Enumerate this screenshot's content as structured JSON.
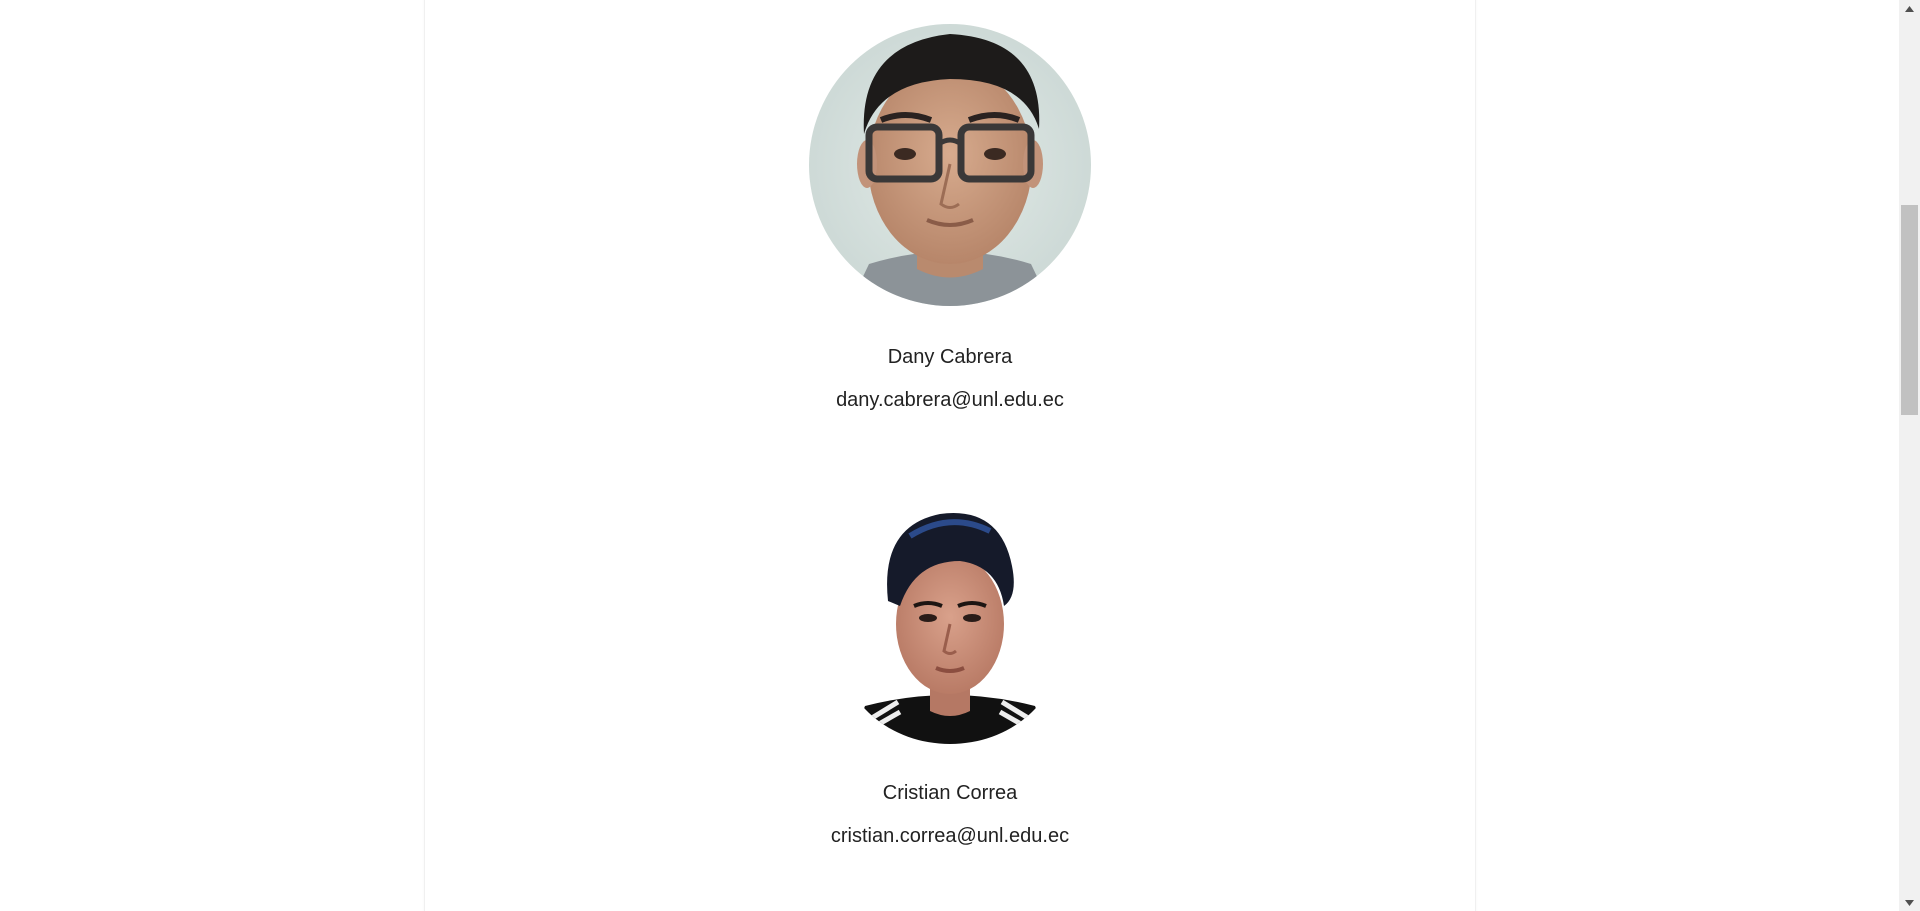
{
  "team": {
    "members": [
      {
        "name": "Dany Cabrera",
        "email": "dany.cabrera@unl.edu.ec",
        "photo": "avatar-photo-man-glasses"
      },
      {
        "name": "Cristian Correa",
        "email": "cristian.correa@unl.edu.ec",
        "photo": "avatar-photo-man-dark-hair"
      }
    ]
  },
  "colors": {
    "text": "#222222",
    "background": "#ffffff",
    "scrollbar_track": "#f1f1f1",
    "scrollbar_thumb": "#c1c1c1"
  },
  "scrollbar": {
    "up_icon": "triangle-up-icon",
    "down_icon": "triangle-down-icon"
  }
}
